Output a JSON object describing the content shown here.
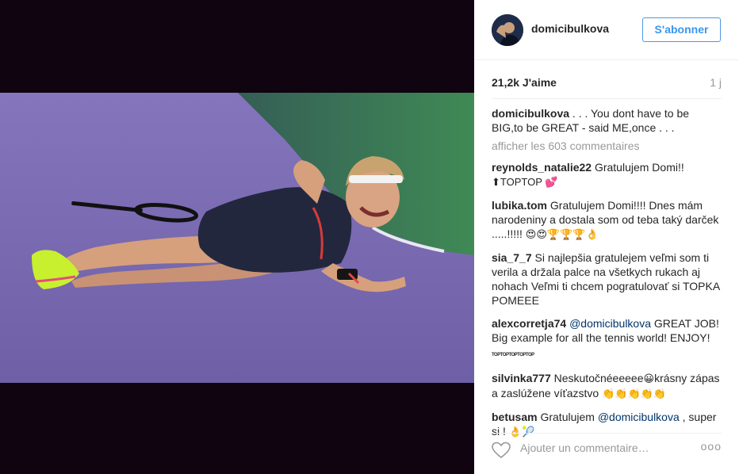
{
  "post": {
    "username": "domicibulkova",
    "follow_label": "S'abonner",
    "likes": "21,2k J'aime",
    "time": "1 j",
    "caption": ". . . You dont have to be BIG,to be GREAT - said ME,once . . .",
    "show_all": "afficher les 603 commentaires",
    "add_comment_placeholder": "Ajouter un commentaire…",
    "more_label": "ooo"
  },
  "comments": [
    {
      "user": "reynolds_natalie22",
      "text": "Gratulujem Domi!!",
      "emoji": "⬆TOPTOP 💕"
    },
    {
      "user": "lubika.tom",
      "text": "Gratulujem Domi!!!! Dnes mám narodeniny a dostala som od teba taký darček .....!!!!!",
      "emoji": "😍😍🏆🏆🏆👌"
    },
    {
      "user": "sia_7_7",
      "text": "Si najlepšia gratulejem veľmi som ti verila a držala palce na všetkych rukach aj nohach Veľmi ti chcem pogratulovať si TOPKA POMEEE"
    },
    {
      "user": "alexcorretja74",
      "mention": "@domicibulkova",
      "text": "GREAT JOB! Big example for all the tennis world! ENJOY!",
      "emoji": "TOPTOPTOPTOPTOP"
    },
    {
      "user": "silvinka777",
      "text_before": "Neskutočnéeeeee",
      "emoji_mid": "😀",
      "text": "krásny zápas a zaslúžene víťazstvo",
      "emoji": "👏👏👏👏👏"
    },
    {
      "user": "betusam",
      "text": "Gratulujem",
      "mention": "@domicibulkova",
      "text_after": ", super si !",
      "emoji": "👌🎾"
    }
  ],
  "icons": {
    "heart": "heart-icon",
    "more": "more-options-icon",
    "avatar": "avatar"
  },
  "colors": {
    "follow_blue": "#3897f0",
    "court_purple": "#7b6bb2",
    "court_green": "#3e7f52",
    "dark_band": "#0f0410"
  }
}
